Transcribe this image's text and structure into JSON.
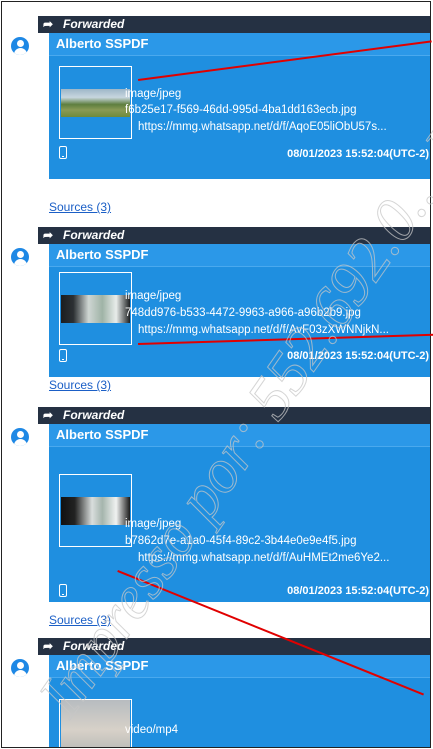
{
  "messages": [
    {
      "forwarded_label": "Forwarded",
      "sender": "Alberto SSPDF",
      "mime": "image/jpeg",
      "filename": "f6b25e17-f569-46dd-995d-4ba1dd163ecb.jpg",
      "url": "https://mmg.whatsapp.net/d/f/AqoE05liObU57s...",
      "timestamp": "08/01/2023 15:52:04(UTC-2)",
      "sources": "Sources (3)"
    },
    {
      "forwarded_label": "Forwarded",
      "sender": "Alberto SSPDF",
      "mime": "image/jpeg",
      "filename": "748dd976-b533-4472-9963-a966-a96b2b9.jpg",
      "url": "https://mmg.whatsapp.net/d/f/AvF03zXWNNjkN...",
      "timestamp": "08/01/2023 15:52:04(UTC-2)",
      "sources": "Sources (3)"
    },
    {
      "forwarded_label": "Forwarded",
      "sender": "Alberto SSPDF",
      "mime": "image/jpeg",
      "filename": "b7862d7e-a1a0-45f4-89c2-3b44e0e9e4f5.jpg",
      "url": "https://mmg.whatsapp.net/d/f/AuHMEt2me6Ye2...",
      "timestamp": "08/01/2023 15:52:04(UTC-2)",
      "sources": "Sources (3)"
    },
    {
      "forwarded_label": "Forwarded",
      "sender": "Alberto SSPDF",
      "mime": "video/mp4"
    }
  ],
  "watermark": "Impresso por: 552.692.0... Em...",
  "colors": {
    "bubble": "#1f8fe0",
    "forward_bar": "#253143",
    "link": "#1b5fc6",
    "annotation": "#e00000"
  }
}
